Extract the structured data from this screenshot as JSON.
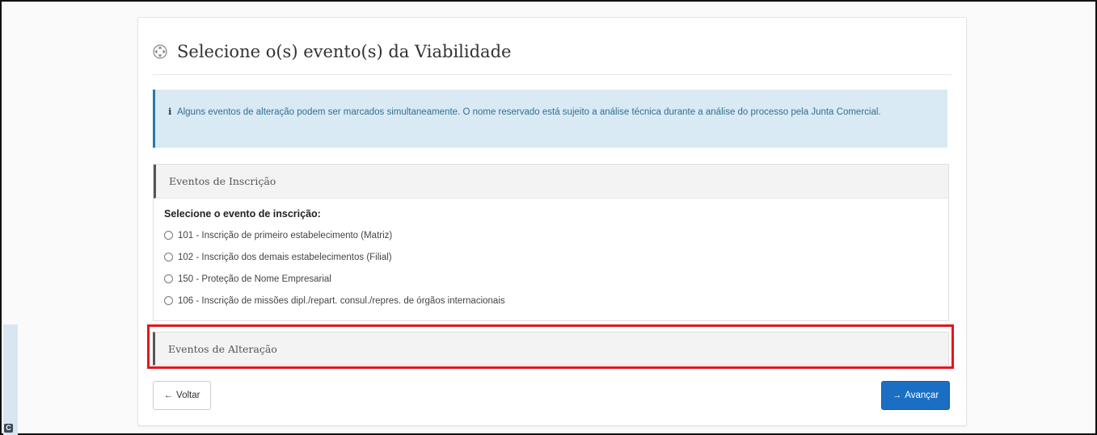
{
  "header": {
    "title": "Selecione o(s) evento(s) da Viabilidade",
    "title_icon": "move-icon"
  },
  "alert": {
    "icon": "info-icon",
    "icon_glyph": "i",
    "text": "Alguns eventos de alteração podem ser marcados simultaneamente. O nome reservado está sujeito a análise técnica durante a análise do processo pela Junta Comercial."
  },
  "inscricao": {
    "heading": "Eventos de Inscrição",
    "select_label": "Selecione o evento de inscrição:",
    "options": [
      "101 - Inscrição de primeiro estabelecimento (Matriz)",
      "102 - Inscrição dos demais estabelecimentos (Filial)",
      "150 - Proteção de Nome Empresarial",
      "106 - Inscrição de missões dipl./repart. consul./repres. de órgãos internacionais"
    ]
  },
  "alteracao": {
    "heading": "Eventos de Alteração"
  },
  "buttons": {
    "back_label": "Voltar",
    "next_label": "Avançar"
  },
  "corner": {
    "glyph": "C"
  },
  "colors": {
    "primary": "#1a6fc4",
    "alert_bg": "#d9eaf4",
    "highlight": "#e4161b"
  }
}
